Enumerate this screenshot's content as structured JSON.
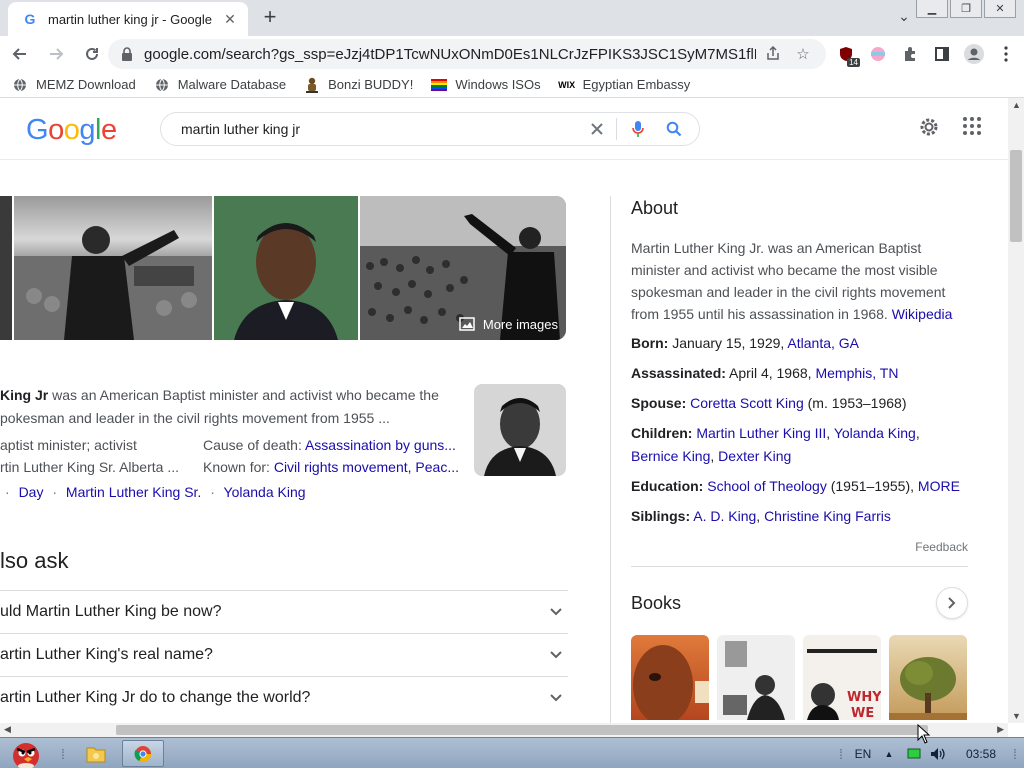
{
  "browser": {
    "tab_title": "martin luther king jr - Google",
    "tab_favicon": "G",
    "url": "google.com/search?gs_ssp=eJzj4tDP1TcwNUxONmD0Es1NLCrJzFPIKS3JSC1SyM7MS1flK...",
    "extension_badge": "14"
  },
  "bookmarks": [
    {
      "label": "MEMZ Download",
      "icon": "globe-icon"
    },
    {
      "label": "Malware Database",
      "icon": "globe-icon"
    },
    {
      "label": "Bonzi BUDDY!",
      "icon": "bonzi-icon"
    },
    {
      "label": "Windows ISOs",
      "icon": "rainbow-flag-icon"
    },
    {
      "label": "Egyptian Embassy",
      "icon": "wix-icon"
    }
  ],
  "google": {
    "logo": "Google",
    "query": "martin luther king jr"
  },
  "images": {
    "more_images_label": "More images"
  },
  "summary": {
    "name_fragment": "King Jr",
    "text_line1": " was an American Baptist minister and activist who became the",
    "text_line2": "pokesman and leader in the civil rights movement from 1955 ..."
  },
  "facts_left": [
    {
      "text": "aptist minister; activist"
    },
    {
      "text": "rtin Luther King Sr. Alberta ..."
    }
  ],
  "facts_right": [
    {
      "label": "Cause of death: ",
      "value": "Assassination by guns..."
    },
    {
      "label": "Known for: ",
      "value": "Civil rights movement, Peac..."
    }
  ],
  "related": [
    "Day",
    "Martin Luther King Sr.",
    "Yolanda King"
  ],
  "people_also_ask": {
    "title": "lso ask",
    "questions": [
      "uld Martin Luther King be now?",
      "artin Luther King's real name?",
      "artin Luther King Jr do to change the world?"
    ]
  },
  "knowledge_panel": {
    "about_title": "About",
    "about_text": "Martin Luther King Jr. was an American Baptist minister and activist who became the most visible spokesman and leader in the civil rights movement from 1955 until his assassination in 1968.",
    "about_source": "Wikipedia",
    "born_label": "Born:",
    "born_text": " January 15, 1929, ",
    "born_link": "Atlanta, GA",
    "assassinated_label": "Assassinated:",
    "assassinated_text": " April 4, 1968, ",
    "assassinated_link": "Memphis, TN",
    "spouse_label": "Spouse:",
    "spouse_link": "Coretta Scott King",
    "spouse_years": " (m. 1953–1968)",
    "children_label": "Children:",
    "child1": "Martin Luther King III",
    "child2": "Yolanda King",
    "child3": "Bernice King",
    "child4": "Dexter King",
    "education_label": "Education:",
    "education_link": "School of Theology",
    "education_years": " (1951–1955), ",
    "education_more": "MORE",
    "siblings_label": "Siblings:",
    "sibling1": "A. D. King",
    "sibling2": "Christine King Farris",
    "feedback": "Feedback",
    "books_title": "Books"
  },
  "taskbar": {
    "language": "EN",
    "clock": "03:58"
  },
  "colors": {
    "link": "#1a0dab",
    "text": "#202124",
    "muted": "#4d5156",
    "tab_bg": "#dee1e6"
  }
}
